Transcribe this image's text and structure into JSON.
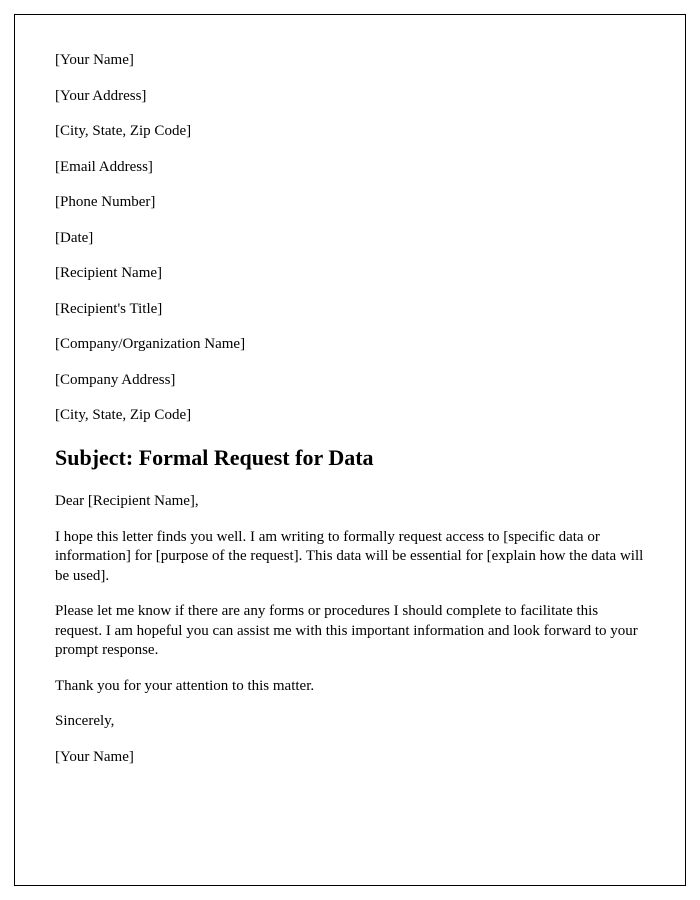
{
  "header": {
    "yourName": "[Your Name]",
    "yourAddress": "[Your Address]",
    "yourCityStateZip": "[City, State, Zip Code]",
    "email": "[Email Address]",
    "phone": "[Phone Number]",
    "date": "[Date]",
    "recipientName": "[Recipient Name]",
    "recipientTitle": "[Recipient's Title]",
    "companyName": "[Company/Organization Name]",
    "companyAddress": "[Company Address]",
    "companyCityStateZip": "[City, State, Zip Code]"
  },
  "subject": "Subject: Formal Request for Data",
  "body": {
    "salutation": "Dear [Recipient Name],",
    "para1": "I hope this letter finds you well. I am writing to formally request access to [specific data or information] for [purpose of the request]. This data will be essential for [explain how the data will be used].",
    "para2": "Please let me know if there are any forms or procedures I should complete to facilitate this request. I am hopeful you can assist me with this important information and look forward to your prompt response.",
    "para3": "Thank you for your attention to this matter.",
    "closing": "Sincerely,",
    "signature": "[Your Name]"
  }
}
